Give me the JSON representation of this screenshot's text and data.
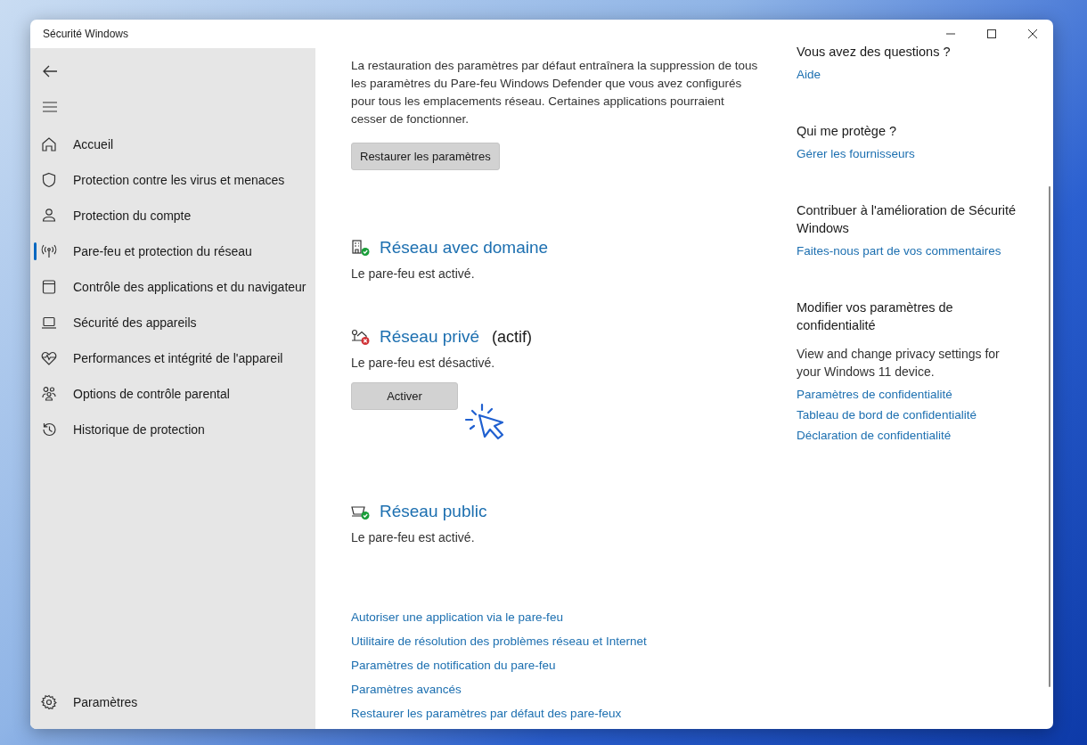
{
  "window": {
    "title": "Sécurité Windows"
  },
  "sidebar": {
    "items": [
      {
        "label": "Accueil",
        "kind": "home",
        "selected": false
      },
      {
        "label": "Protection contre les virus et menaces",
        "kind": "virus",
        "selected": false
      },
      {
        "label": "Protection du compte",
        "kind": "account",
        "selected": false
      },
      {
        "label": "Pare-feu et protection du réseau",
        "kind": "firewall",
        "selected": true
      },
      {
        "label": "Contrôle des applications et du navigateur",
        "kind": "apps",
        "selected": false
      },
      {
        "label": "Sécurité des appareils",
        "kind": "device",
        "selected": false
      },
      {
        "label": "Performances et intégrité de l'appareil",
        "kind": "health",
        "selected": false
      },
      {
        "label": "Options de contrôle parental",
        "kind": "family",
        "selected": false
      },
      {
        "label": "Historique de protection",
        "kind": "history",
        "selected": false
      }
    ],
    "settings": {
      "label": "Paramètres"
    }
  },
  "main": {
    "intro": "La restauration des paramètres par défaut entraînera la suppression de tous les paramètres du Pare-feu Windows Defender que vous avez configurés pour tous les emplacements réseau. Certaines applications pourraient cesser de fonctionner.",
    "restore_button": "Restaurer les paramètres",
    "networks": [
      {
        "kind": "domain",
        "name": "Réseau avec domaine",
        "status": "Le pare-feu est activé.",
        "firewall_on": true
      },
      {
        "kind": "private",
        "name": "Réseau privé",
        "active_label": "(actif)",
        "status": "Le pare-feu est désactivé.",
        "firewall_on": false,
        "button": "Activer"
      },
      {
        "kind": "public",
        "name": "Réseau public",
        "status": "Le pare-feu est activé.",
        "firewall_on": true
      }
    ],
    "links": [
      "Autoriser une application via le pare-feu",
      "Utilitaire de résolution des problèmes réseau et Internet",
      "Paramètres de notification du pare-feu",
      "Paramètres avancés",
      "Restaurer les paramètres par défaut des pare-feux"
    ]
  },
  "aside": [
    {
      "heading": "Vous avez des questions ?",
      "links": [
        "Aide"
      ]
    },
    {
      "heading": "Qui me protège ?",
      "links": [
        "Gérer les fournisseurs"
      ]
    },
    {
      "heading": "Contribuer à l'amélioration de Sécurité Windows",
      "links": [
        "Faites-nous part de vos commentaires"
      ]
    },
    {
      "heading": "Modifier vos paramètres de confidentialité",
      "text": "View and change privacy settings for your Windows 11 device.",
      "links": [
        "Paramètres de confidentialité",
        "Tableau de bord de confidentialité",
        "Déclaration de confidentialité"
      ]
    }
  ]
}
